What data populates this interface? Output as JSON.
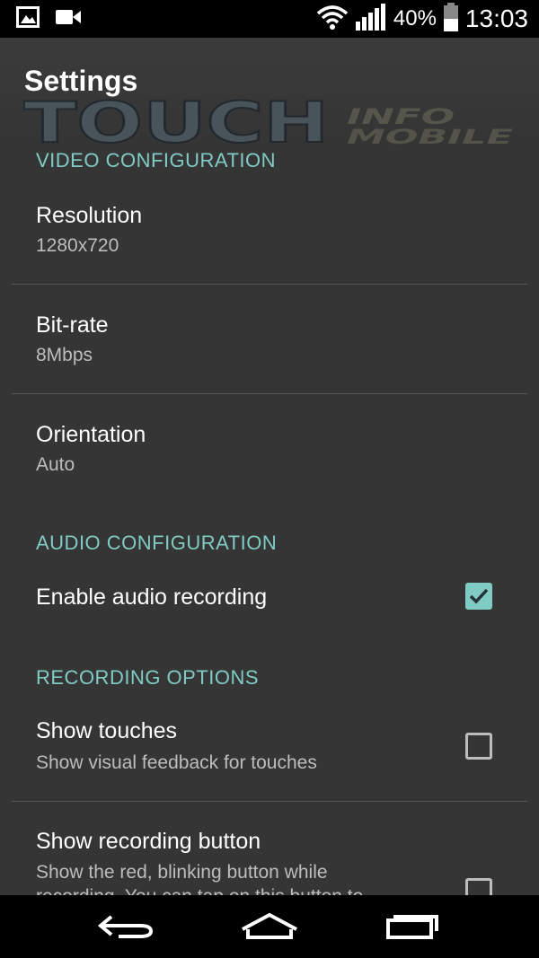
{
  "status_bar": {
    "battery_percent": "40%",
    "time": "13:03",
    "icons": [
      "gallery-icon",
      "video-camera-icon",
      "wifi-icon",
      "signal-icon",
      "battery-icon"
    ]
  },
  "action_bar": {
    "title": "Settings"
  },
  "watermark": {
    "line1": "TOUCH",
    "line2": "INFO",
    "line3": "MOBILE"
  },
  "sections": {
    "video": {
      "header": "VIDEO CONFIGURATION",
      "resolution": {
        "title": "Resolution",
        "summary": "1280x720"
      },
      "bitrate": {
        "title": "Bit-rate",
        "summary": "8Mbps"
      },
      "orientation": {
        "title": "Orientation",
        "summary": "Auto"
      }
    },
    "audio": {
      "header": "AUDIO CONFIGURATION",
      "enable_audio": {
        "title": "Enable audio recording",
        "checked": true
      }
    },
    "recording": {
      "header": "RECORDING OPTIONS",
      "show_touches": {
        "title": "Show touches",
        "summary": "Show visual feedback for touches",
        "checked": false
      },
      "show_recording_button": {
        "title": "Show recording button",
        "summary_line1": "Show the red, blinking button while",
        "summary_line2": "recording. You can tap on this button to",
        "checked": false
      }
    }
  },
  "colors": {
    "accent": "#80cbc4",
    "background": "#353535",
    "bars": "#000000"
  },
  "nav_bar": {
    "icons": [
      "back-icon",
      "home-icon",
      "recent-apps-icon"
    ]
  }
}
